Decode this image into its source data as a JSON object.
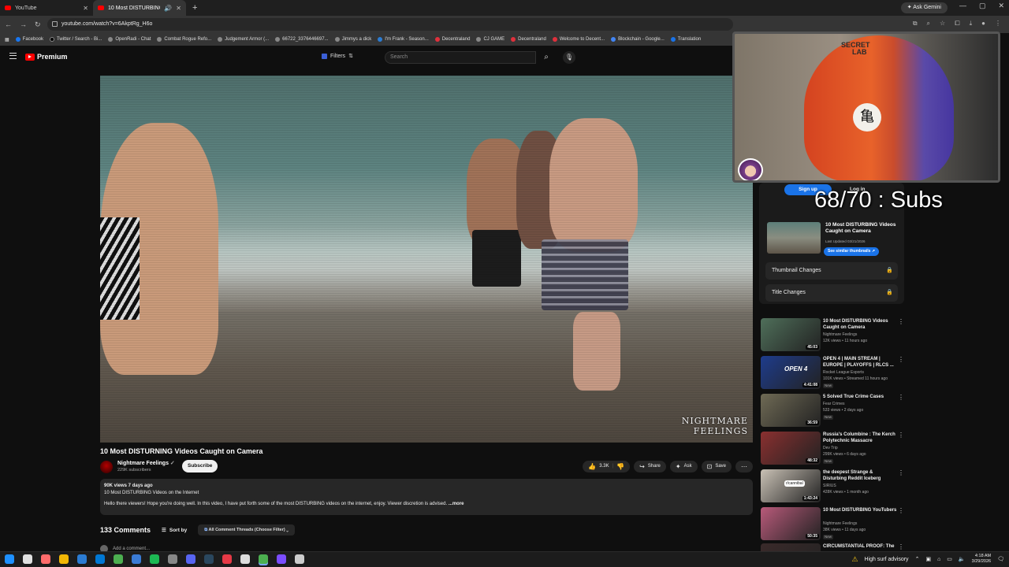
{
  "browser": {
    "tabs": [
      {
        "title": "YouTube",
        "active": false
      },
      {
        "title": "10 Most DISTURBING Vide",
        "active": true
      }
    ],
    "ask_gemini": "Ask Gemini",
    "url": "youtube.com/watch?v=6AkptRg_H6o",
    "bookmarks": [
      "Facebook",
      "Twitter / Search - Bi...",
      "OpenRadi - Chat",
      "Combat Rogue Refo...",
      "Judgement Armor (...",
      "66722_3376446697...",
      "Jimmys a dick",
      "I'm Frank - Season...",
      "Decentraland",
      "CJ GAME",
      "Decentraland",
      "Welcome to Decent...",
      "Blockchain - Google...",
      "Translation"
    ]
  },
  "youtube": {
    "logo": "Premium",
    "filters_label": "Filters",
    "search_placeholder": "Search"
  },
  "video": {
    "watermark_line1": "NIGHTMARE",
    "watermark_line2": "FEELINGS",
    "title": "10 Most DISTURNING Videos Caught on Camera",
    "channel": "Nightmare Feelings",
    "subscribers": "229K subscribers",
    "subscribe_label": "Subscribe",
    "likes": "3.3K",
    "share": "Share",
    "ask": "Ask",
    "save": "Save",
    "views_date": "90K views  7 days ago",
    "desc_line1": "10 Most DISTURBING Videos on the Internet",
    "desc_line2": "Hello there viewers! Hope you're doing well. In this video,  I have put forth some of the most DISTURBING videos on the internet, enjoy. Viewer discretion is advised.",
    "more": "...more",
    "comments_count": "133 Comments",
    "sort_by": "Sort by",
    "thread_filter": "All Comment Threads (Choose Filter)",
    "add_comment": "Add a comment..."
  },
  "overlay": {
    "subs_counter": "68/70 : Subs",
    "webcam_brand_1": "SECRET",
    "webcam_brand_2": "LAB",
    "webcam_kanji": "亀"
  },
  "studio_card": {
    "signup": "Sign up",
    "login": "Log in",
    "title": "10 Most DISTURBING Videos Caught on Camera",
    "updated": "Last Updated 03/21/2026",
    "button": "See similar thumbnails",
    "thumbnail_changes": "Thumbnail Changes",
    "title_changes": "Title Changes"
  },
  "recommendations": [
    {
      "title": "10 Most DISTURBING Videos Caught on Camera",
      "channel": "Nightmare Feelings",
      "stats": "12K views • 11 hours ago",
      "badge": "",
      "duration": "45:03",
      "color": "#4f6f5a"
    },
    {
      "title": "OPEN 4 | MAIN STREAM | EUROPE | PLAYOFFS | RLCS ...",
      "channel": "Rocket League Esports",
      "stats": "101K views • Streamed 11 hours ago",
      "badge": "New",
      "duration": "4:41:08",
      "color": "#1e3c8c"
    },
    {
      "title": "5 Solved True Crime Cases",
      "channel": "Fear Crimes",
      "stats": "533 views • 2 days ago",
      "badge": "New",
      "duration": "36:59",
      "color": "#6f6a55"
    },
    {
      "title": "Russia's Columbine : The Kerch Polytechnic Massacre",
      "channel": "Dev Trip",
      "stats": "299K views • 6 days ago",
      "badge": "New",
      "duration": "48:32",
      "color": "#8a3030"
    },
    {
      "title": "the deepest Strange & Disturbing Reddit Iceberg",
      "channel": "SIRIUS",
      "stats": "428K views • 1 month ago",
      "badge": "",
      "duration": "1:43:24",
      "color": "#c9c1b5"
    },
    {
      "title": "10 Most DISTURBING YouTubers",
      "channel": "Nightmare Feelings",
      "stats": "38K views • 11 days ago",
      "badge": "New",
      "duration": "50:35",
      "color": "#b85a7a"
    },
    {
      "title": "CIRCUMSTANTIAL PROOF: The",
      "channel": "",
      "stats": "",
      "badge": "",
      "duration": "",
      "color": "#3a2a2a"
    }
  ],
  "rec_thumb_texts": {
    "r1": "OPEN 4",
    "r4": "r/cannibal"
  },
  "taskbar": {
    "advisory": "High surf advisory",
    "time": "4:18 AM",
    "date": "3/29/2026",
    "icon_colors": [
      "#1e90ff",
      "#e0e0e0",
      "#ff6b6b",
      "#f2b705",
      "#2b7cd3",
      "#0078d4",
      "#4caf50",
      "#3a7bd5",
      "#1db954",
      "#888888",
      "#5865f2",
      "#2a475e",
      "#e63946",
      "#dddddd",
      "#4caf50",
      "#7b4dff",
      "#cccccc"
    ]
  }
}
